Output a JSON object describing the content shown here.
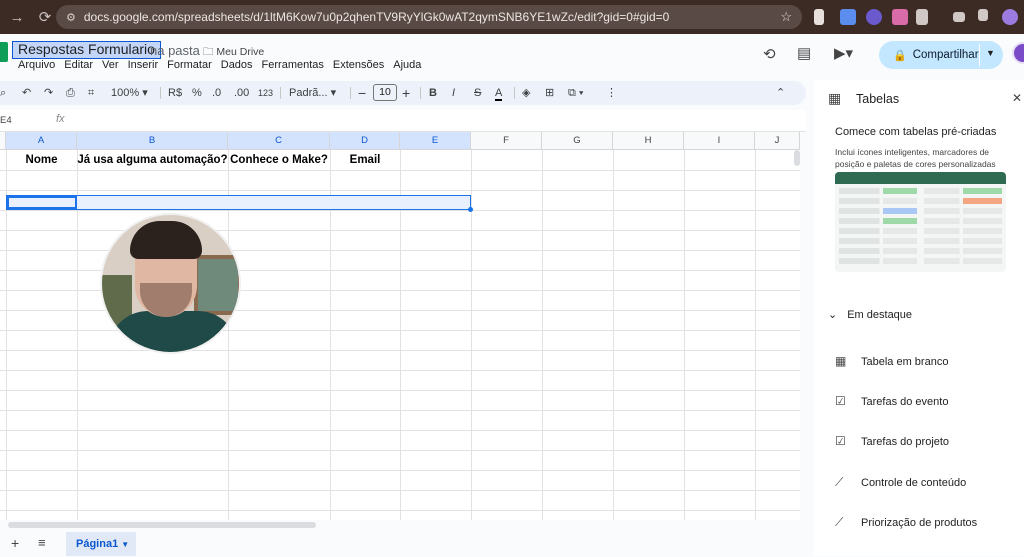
{
  "browser": {
    "url": "docs.google.com/spreadsheets/d/1ltM6Kow7u0p2qhenTV9RyYlGk0wAT2qymSNB6YE1wZc/edit?gid=0#gid=0"
  },
  "header": {
    "doc_title": "Respostas Formulario",
    "folder_prefix": "na pasta",
    "folder_name": "Meu Drive",
    "menu": [
      "Arquivo",
      "Editar",
      "Ver",
      "Inserir",
      "Formatar",
      "Dados",
      "Ferramentas",
      "Extensões",
      "Ajuda"
    ],
    "share_label": "Compartilhar"
  },
  "toolbar": {
    "zoom": "100%",
    "currency": "R$",
    "percent": "%",
    "dec_decrease": ".0",
    "dec_increase": ".00",
    "number_format": "123",
    "font": "Padrã...",
    "font_size": "10"
  },
  "formula_bar": {
    "name_box": "E4",
    "fx": "fx"
  },
  "grid": {
    "columns": [
      "A",
      "B",
      "C",
      "D",
      "E",
      "F",
      "G",
      "H",
      "I",
      "J"
    ],
    "header_row": [
      "Nome",
      "Já usa alguma automação?",
      "Conhece o Make?",
      "Email"
    ]
  },
  "sheets": {
    "active_tab": "Página1"
  },
  "panel": {
    "title": "Tabelas",
    "subtitle": "Comece com tabelas pré-criadas",
    "description": "Inclui ícones inteligentes, marcadores de posição e paletas de cores personalizadas",
    "section": "Em destaque",
    "items": [
      {
        "label": "Tabela em branco",
        "icon": "table-icon"
      },
      {
        "label": "Tarefas do evento",
        "icon": "checklist-icon"
      },
      {
        "label": "Tarefas do projeto",
        "icon": "checklist-icon"
      },
      {
        "label": "Controle de conteúdo",
        "icon": "trend-icon"
      },
      {
        "label": "Priorização de produtos",
        "icon": "trend-icon"
      }
    ]
  },
  "colors": {
    "accent": "#0b57d0",
    "share_bg": "#c2e7ff",
    "toolbar_bg": "#edf2fa",
    "browser_bg": "#3c2a24"
  }
}
